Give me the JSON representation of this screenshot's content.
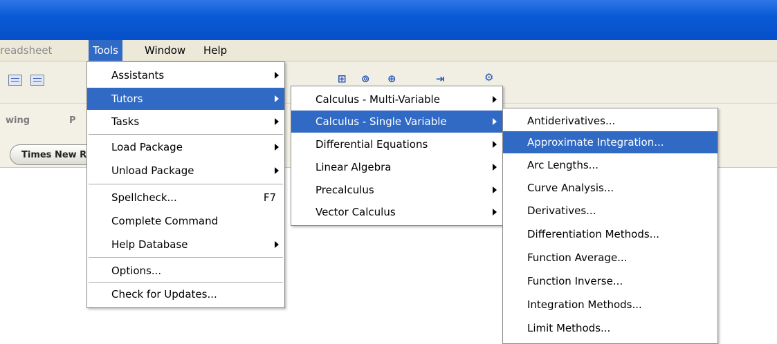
{
  "menubar": {
    "items": [
      {
        "label": "readsheet",
        "state": "gray"
      },
      {
        "label": "Tools",
        "state": "active"
      },
      {
        "label": "Window",
        "state": "normal"
      },
      {
        "label": "Help",
        "state": "normal"
      }
    ]
  },
  "toolbar": {
    "section_labels": [
      "wing",
      "P"
    ],
    "font_selector": "Times New Roman"
  },
  "tools_menu": {
    "items": [
      {
        "label": "Assistants",
        "submenu": true
      },
      {
        "label": "Tutors",
        "submenu": true,
        "highlighted": true
      },
      {
        "label": "Tasks",
        "submenu": true
      },
      {
        "label": "Load Package",
        "submenu": true
      },
      {
        "label": "Unload Package",
        "submenu": true
      },
      {
        "label": "Spellcheck...",
        "shortcut": "F7"
      },
      {
        "label": "Complete Command"
      },
      {
        "label": "Help Database",
        "submenu": true
      },
      {
        "label": "Options..."
      },
      {
        "label": "Check for Updates..."
      }
    ]
  },
  "tutors_menu": {
    "items": [
      {
        "label": "Calculus - Multi-Variable",
        "submenu": true
      },
      {
        "label": "Calculus - Single Variable",
        "submenu": true,
        "highlighted": true
      },
      {
        "label": "Differential Equations",
        "submenu": true
      },
      {
        "label": "Linear Algebra",
        "submenu": true
      },
      {
        "label": "Precalculus",
        "submenu": true
      },
      {
        "label": "Vector Calculus",
        "submenu": true
      }
    ]
  },
  "single_variable_menu": {
    "items": [
      {
        "label": "Antiderivatives..."
      },
      {
        "label": "Approximate Integration...",
        "highlighted": true
      },
      {
        "label": "Arc Lengths..."
      },
      {
        "label": "Curve Analysis..."
      },
      {
        "label": "Derivatives..."
      },
      {
        "label": "Differentiation Methods..."
      },
      {
        "label": "Function Average..."
      },
      {
        "label": "Function Inverse..."
      },
      {
        "label": "Integration Methods..."
      },
      {
        "label": "Limit Methods..."
      }
    ]
  },
  "colors": {
    "titlebar": "#0a5ad6",
    "highlight": "#316ac5",
    "menu_bg": "#ffffff",
    "menubar_bg": "#ece9d8"
  }
}
